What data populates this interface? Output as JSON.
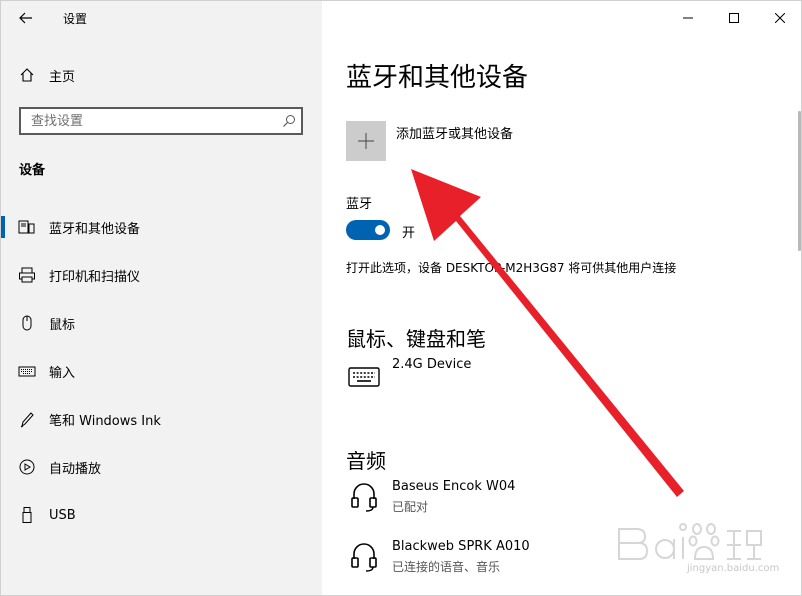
{
  "app": {
    "title": "设置"
  },
  "nav": {
    "home_label": "主页",
    "search_placeholder": "查找设置",
    "section_title": "设备",
    "items": [
      {
        "label": "蓝牙和其他设备",
        "icon": "bluetooth-devices-icon",
        "active": true
      },
      {
        "label": "打印机和扫描仪",
        "icon": "printer-icon",
        "active": false
      },
      {
        "label": "鼠标",
        "icon": "mouse-icon",
        "active": false
      },
      {
        "label": "输入",
        "icon": "keyboard-icon",
        "active": false
      },
      {
        "label": "笔和 Windows Ink",
        "icon": "pen-icon",
        "active": false
      },
      {
        "label": "自动播放",
        "icon": "autoplay-icon",
        "active": false
      },
      {
        "label": "USB",
        "icon": "usb-icon",
        "active": false
      }
    ]
  },
  "main": {
    "title": "蓝牙和其他设备",
    "add_device_label": "添加蓝牙或其他设备",
    "bluetooth_label": "蓝牙",
    "toggle_state": "开",
    "discoverable_text": "打开此选项，设备 DESKTOP-M2H3G87 将可供其他用户连接",
    "mouse_section": "鼠标、键盘和笔",
    "mouse_devices": [
      {
        "name": "2.4G Device",
        "status": ""
      }
    ],
    "audio_section": "音频",
    "audio_devices": [
      {
        "name": "Baseus Encok W04",
        "status": "已配对"
      },
      {
        "name": "Blackweb SPRK A010",
        "status": "已连接的语音、音乐"
      }
    ]
  },
  "colors": {
    "accent": "#0063b1",
    "annotation_arrow": "#e8202a",
    "left_pane": "#f2f2f2"
  },
  "watermark": {
    "logo": "Baidu经验",
    "url": "jingyan.baidu.com"
  }
}
